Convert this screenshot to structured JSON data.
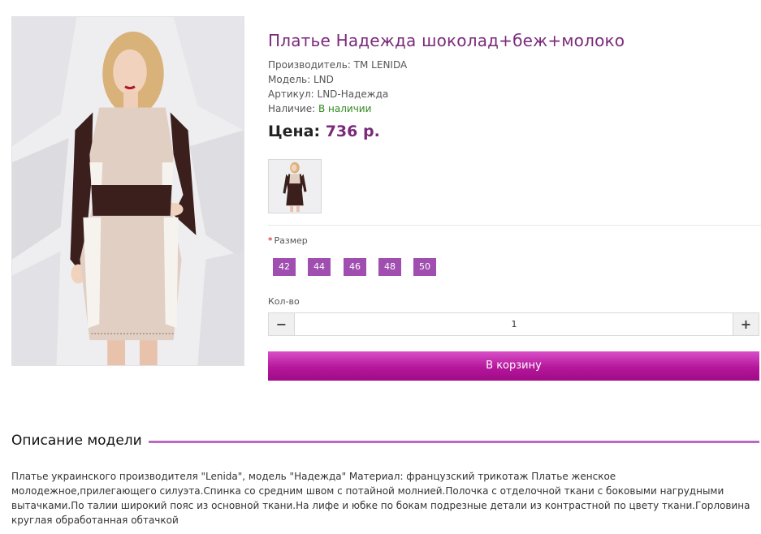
{
  "product": {
    "title": "Платье Надежда шоколад+беж+молоко",
    "manufacturer_label": "Производитель:",
    "manufacturer": "TM LENIDA",
    "model_label": "Модель:",
    "model": "LND",
    "sku_label": "Артикул:",
    "sku": "LND-Надежда",
    "availability_label": "Наличие:",
    "availability": "В наличии",
    "price_label": "Цена:",
    "price": "736 р."
  },
  "options": {
    "size_required_mark": "*",
    "size_label": "Размер",
    "sizes": [
      "42",
      "44",
      "46",
      "48",
      "50"
    ],
    "qty_label": "Кол-во",
    "qty_value": "1",
    "minus_symbol": "−",
    "plus_symbol": "+"
  },
  "cart": {
    "button_label": "В корзину"
  },
  "description": {
    "title": "Описание модели",
    "text": "Платье украинского производителя \"Lenida\", модель \"Надежда\" Материал: французский трикотаж Платье женское молодежное,прилегающего силуэта.Спинка со средним швом с потайной молнией.Полочка с отделочной ткани с боковыми нагрудными вытачками.По талии широкий пояс из основной ткани.На лифе и юбке по бокам подрезные детали из контрастной по цвету ткани.Горловина круглая обработанная обтачкой"
  },
  "colors": {
    "accent": "#7a2a7a",
    "size_button": "#a04fb0",
    "cart_button": "#b5179b",
    "in_stock": "#2f8a1f",
    "dress_beige": "#e2cfc4",
    "dress_chocolate": "#3b1f1c",
    "dress_milk": "#f6f3ef"
  }
}
